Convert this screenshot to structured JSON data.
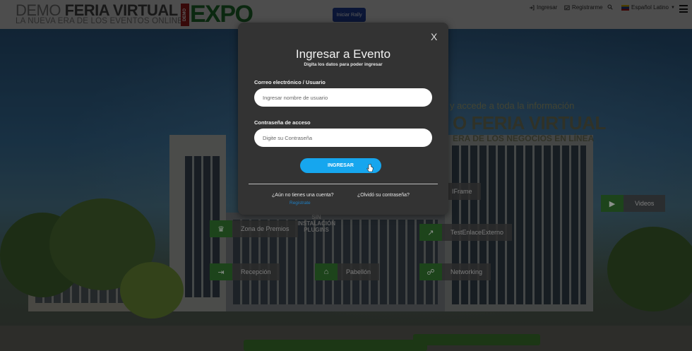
{
  "header": {
    "brand_line1_a": "DEMO",
    "brand_line1_b": "FERIA VIRTUAL",
    "brand_line2": "LA NUEVA ERA DE LOS EVENTOS ONLINE",
    "logo_demo": "DEMO",
    "logo_expo": "EXPO",
    "rally_button": "Iniciar Rally",
    "nav_login": "Ingresar",
    "nav_register": "Registrarme",
    "language": "Español Latino"
  },
  "background": {
    "promo_line1": "y accede a toda la información",
    "promo_line2": "O FERIA VIRTUAL",
    "promo_line3": "ERA DE LOS NEGOCIOS EN LÍNEA",
    "sign_text": "SIN INSTALACIÓN PLUGINS",
    "zones": [
      {
        "label": "IFrame",
        "icon": "iframe-icon"
      },
      {
        "label": "Videos",
        "icon": "video-camera-icon"
      },
      {
        "label": "Zona de Premios",
        "icon": "trophy-icon"
      },
      {
        "label": "TestEnlaceExterno",
        "icon": "external-link-icon"
      },
      {
        "label": "Recepción",
        "icon": "signpost-icon"
      },
      {
        "label": "Pabellón",
        "icon": "pavilion-icon"
      },
      {
        "label": "Networking",
        "icon": "network-icon"
      }
    ]
  },
  "modal": {
    "close": "X",
    "title": "Ingresar a Evento",
    "subtitle": "Digita los datos para poder ingresar",
    "email_label": "Correo electrónico / Usuario",
    "email_placeholder": "Ingresar nombre de usuario",
    "password_label": "Contraseña de acceso",
    "password_placeholder": "Digite su Contraseña",
    "submit": "INGRESAR",
    "no_account": "¿Aún no tienes una cuenta?",
    "register_link": "Registrate",
    "forgot_password": "¿Olvidó su contraseña?"
  },
  "colors": {
    "accent": "#16a6ee",
    "modal_bg": "#333333",
    "zone_icon_bg": "#2f6e2c",
    "rally_button": "#1e3c8c"
  }
}
